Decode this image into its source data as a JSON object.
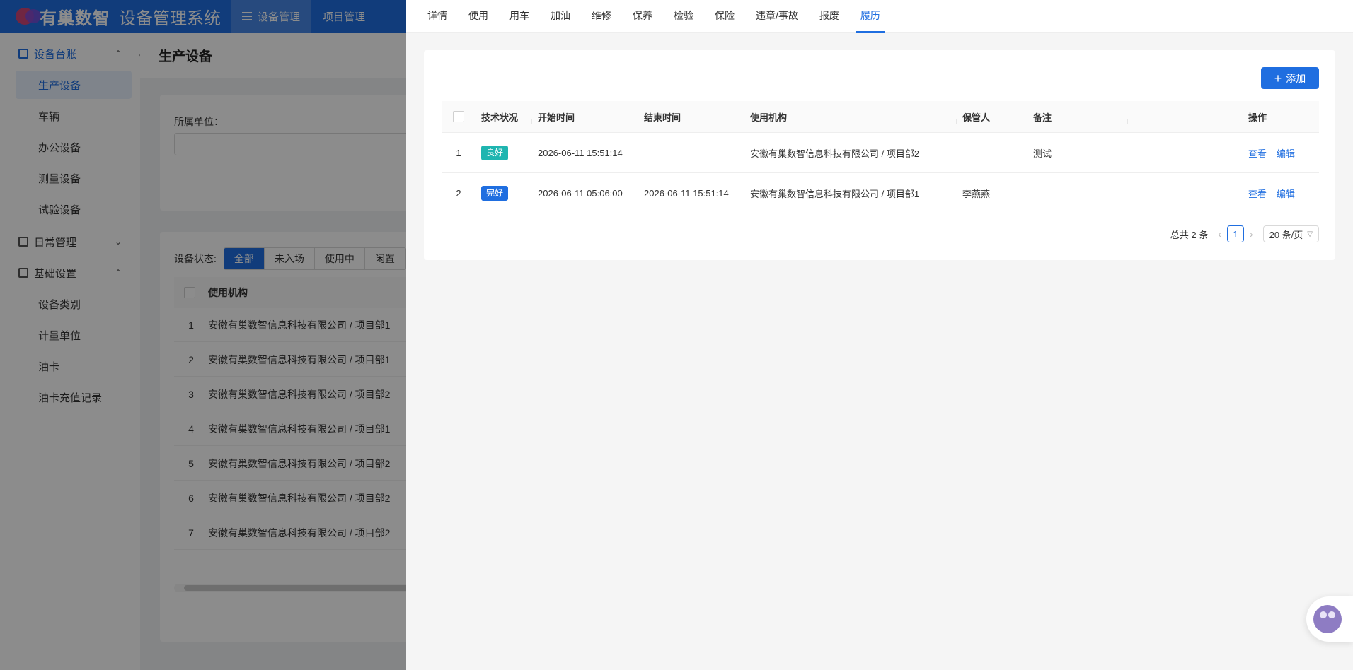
{
  "app": {
    "logo_text": "有巢数智",
    "system_title": "设备管理系统",
    "top_nav": [
      "设备管理",
      "项目管理"
    ]
  },
  "sidebar": {
    "groups": [
      {
        "label": "设备台账",
        "items": [
          "生产设备",
          "车辆",
          "办公设备",
          "测量设备",
          "试验设备"
        ]
      },
      {
        "label": "日常管理",
        "items": []
      },
      {
        "label": "基础设置",
        "items": [
          "设备类别",
          "计量单位",
          "油卡",
          "油卡充值记录"
        ]
      }
    ]
  },
  "page": {
    "title": "生产设备",
    "filter_label": "所属单位：",
    "status_label": "设备状态:",
    "status_options": [
      "全部",
      "未入场",
      "使用中",
      "闲置"
    ],
    "table_header": "使用机构",
    "rows": [
      {
        "n": "1",
        "org": "安徽有巢数智信息科技有限公司 / 项目部1"
      },
      {
        "n": "2",
        "org": "安徽有巢数智信息科技有限公司 / 项目部1"
      },
      {
        "n": "3",
        "org": "安徽有巢数智信息科技有限公司 / 项目部2"
      },
      {
        "n": "4",
        "org": "安徽有巢数智信息科技有限公司 / 项目部1"
      },
      {
        "n": "5",
        "org": "安徽有巢数智信息科技有限公司 / 项目部2"
      },
      {
        "n": "6",
        "org": "安徽有巢数智信息科技有限公司 / 项目部2"
      },
      {
        "n": "7",
        "org": "安徽有巢数智信息科技有限公司 / 项目部2"
      }
    ]
  },
  "drawer": {
    "tabs": [
      "详情",
      "使用",
      "用车",
      "加油",
      "维修",
      "保养",
      "检验",
      "保险",
      "违章/事故",
      "报废",
      "履历"
    ],
    "active_tab": "履历",
    "add_label": "添加",
    "columns": [
      "技术状况",
      "开始时间",
      "结束时间",
      "使用机构",
      "保管人",
      "备注",
      "",
      "操作"
    ],
    "rows": [
      {
        "n": "1",
        "status": "良好",
        "status_color": "#1fb5b0",
        "start": "2026-06-11 15:51:14",
        "end": "",
        "org": "安徽有巢数智信息科技有限公司 / 项目部2",
        "keeper": "",
        "note": "测试",
        "view": "查看",
        "edit": "编辑"
      },
      {
        "n": "2",
        "status": "完好",
        "status_color": "#1f6ee0",
        "start": "2026-06-11 05:06:00",
        "end": "2026-06-11 15:51:14",
        "org": "安徽有巢数智信息科技有限公司 / 项目部1",
        "keeper": "李燕燕",
        "note": "",
        "view": "查看",
        "edit": "编辑"
      }
    ],
    "pagination": {
      "total_text": "总共 2 条",
      "current_page": "1",
      "page_size": "20 条/页"
    }
  },
  "colors": {
    "primary": "#1f6ee0",
    "tag_good": "#1fb5b0",
    "tag_intact": "#1f6ee0"
  }
}
